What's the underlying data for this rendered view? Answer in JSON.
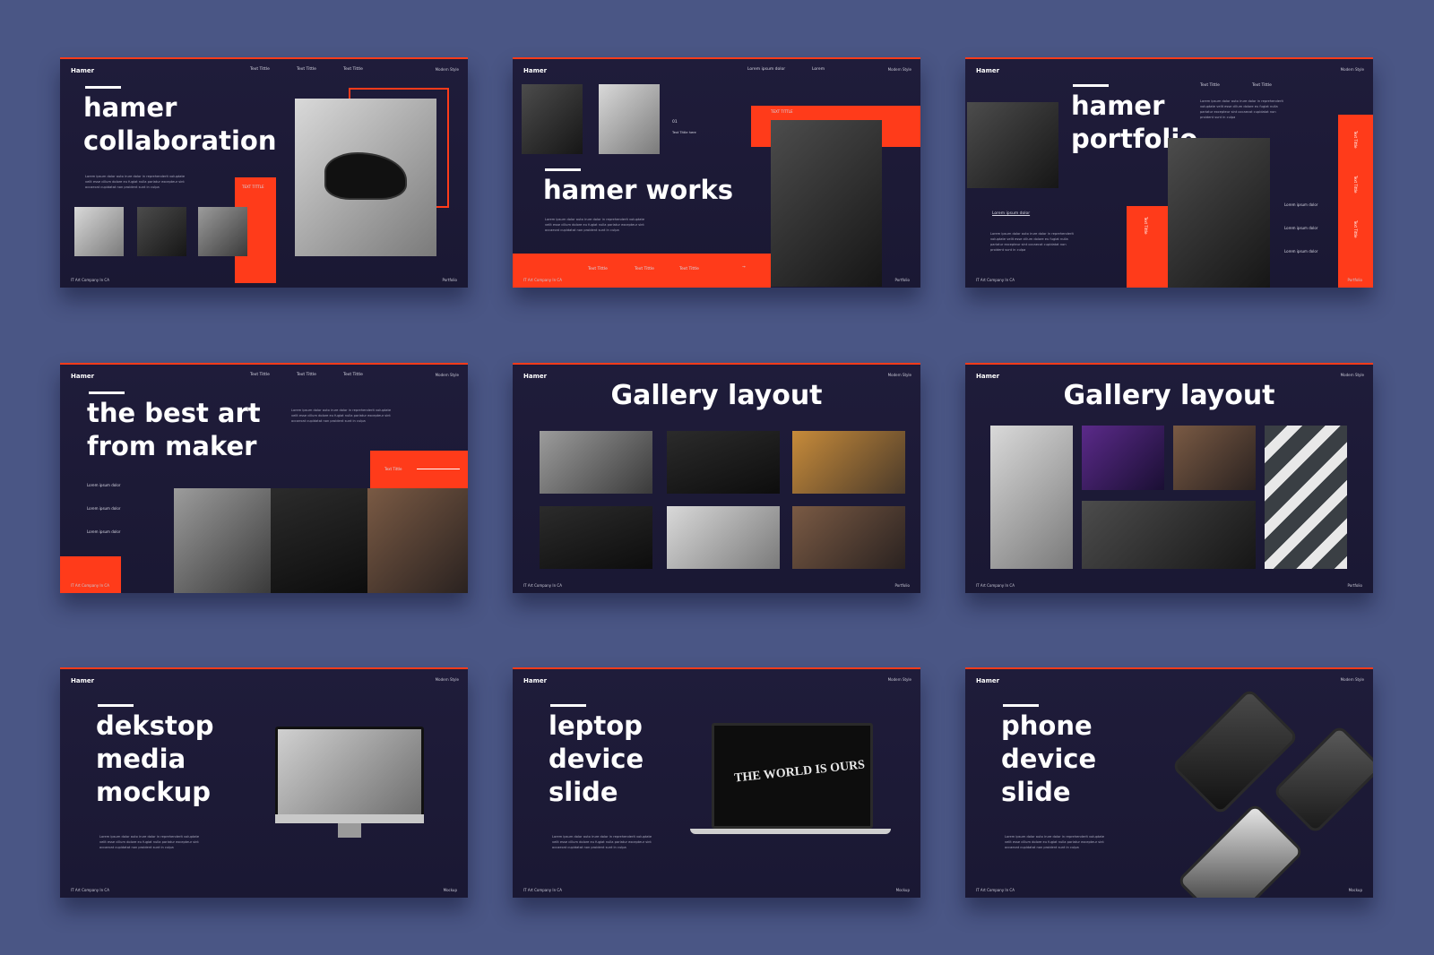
{
  "brand": "Hamer",
  "tagline": "Modern Style",
  "footer_company": "IT Art Company In CA",
  "lorem_para": "Lorem ipsum dolor auto irure dolor in reprehenderit voluptate velit esse cillum dolore eu fugiat nulla pariatur excepteur sint occaecat cupidatat non proident sunt in culpa",
  "accent_color": "#ff3b1a",
  "slide1": {
    "title_line1": "hamer",
    "title_line2": "collaboration",
    "nav": [
      "Text Tittle",
      "Text Tittle",
      "Text Tittle"
    ],
    "red_label": "TEXT TITTLE",
    "footer_right": "Portfolio"
  },
  "slide2": {
    "title": "hamer works",
    "nav": [
      "Lorem ipsum dolor",
      "Lorem"
    ],
    "red_label": "TEXT TITTLE",
    "side_num": "01",
    "side_title": "Text Tittle here",
    "bottom_nav": [
      "Text Tittle",
      "Text Tittle",
      "Text Tittle"
    ],
    "arrow": "→",
    "footer_right": "Portfolio"
  },
  "slide3": {
    "title_line1": "hamer",
    "title_line2": "portfolio",
    "nav": [
      "Text Tittle",
      "Text Tittle"
    ],
    "link": "Lorem ipsum dolor",
    "vertical_label": "Text Tittle",
    "list": [
      "Lorem ipsum dolor",
      "Lorem ipsum dolor",
      "Lorem ipsum dolor"
    ],
    "vertical_list": [
      "Text Tittle",
      "Text Tittle",
      "Text Tittle"
    ],
    "footer_right": "Portfolio"
  },
  "slide4": {
    "title_line1": "the best art",
    "title_line2": "from maker",
    "nav": [
      "Text Tittle",
      "Text Tittle",
      "Text Tittle"
    ],
    "red_label": "Text Tittle",
    "list": [
      "Lorem ipsum dolor",
      "Lorem ipsum dolor",
      "Lorem ipsum dolor"
    ],
    "footer_right": ""
  },
  "slide5": {
    "title": "Gallery layout",
    "footer_right": "Portfolio"
  },
  "slide6": {
    "title": "Gallery layout",
    "footer_right": "Portfolio"
  },
  "slide7": {
    "title_line1": "dekstop",
    "title_line2": "media",
    "title_line3": "mockup",
    "footer_right": "Mockup"
  },
  "slide8": {
    "title_line1": "leptop",
    "title_line2": "device",
    "title_line3": "slide",
    "screen_text": "THE WORLD IS OURS",
    "footer_right": "Mockup"
  },
  "slide9": {
    "title_line1": "phone",
    "title_line2": "device",
    "title_line3": "slide",
    "footer_right": "Mockup"
  }
}
